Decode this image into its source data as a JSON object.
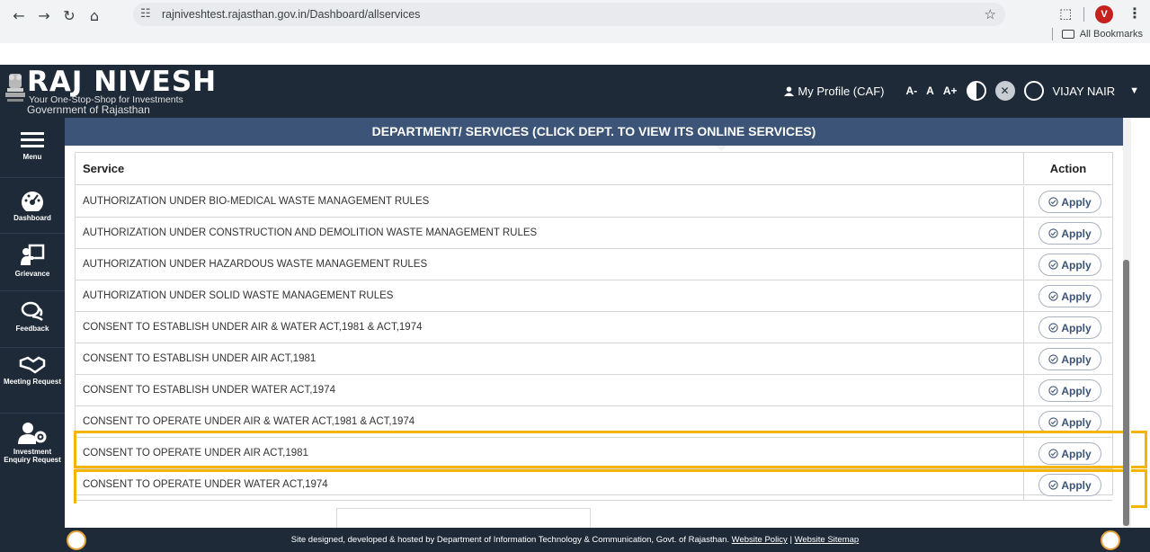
{
  "browser": {
    "url": "rajniveshtest.rajasthan.gov.in/Dashboard/allservices",
    "profile_initial": "V",
    "bookmarks_label": "All Bookmarks"
  },
  "header": {
    "brand": "RAJ NIVESH",
    "tagline": "Your One-Stop-Shop for Investments",
    "government": "Government of Rajasthan",
    "profile_link": "My Profile (CAF)",
    "font_small": "A-",
    "font_normal": "A",
    "font_large": "A+",
    "user_name": "VIJAY NAIR"
  },
  "sidebar": {
    "items": [
      {
        "label": "Menu",
        "icon": "hamburger-icon"
      },
      {
        "label": "Dashboard",
        "icon": "gauge-icon"
      },
      {
        "label": "Grievance",
        "icon": "presenter-icon"
      },
      {
        "label": "Feedback",
        "icon": "chat-icon"
      },
      {
        "label": "Meeting Request",
        "icon": "handshake-icon"
      },
      {
        "label": "Investment Enquiry Request",
        "icon": "user-gear-icon"
      }
    ]
  },
  "page": {
    "dept_heading": "DEPARTMENT/ SERVICES (CLICK DEPT. TO VIEW ITS ONLINE SERVICES)"
  },
  "table": {
    "col_service": "Service",
    "col_action": "Action",
    "apply_label": "Apply",
    "rows": [
      "AUTHORIZATION UNDER BIO-MEDICAL WASTE MANAGEMENT RULES",
      "AUTHORIZATION UNDER CONSTRUCTION AND DEMOLITION WASTE MANAGEMENT RULES",
      "AUTHORIZATION UNDER HAZARDOUS WASTE MANAGEMENT RULES",
      "AUTHORIZATION UNDER SOLID WASTE MANAGEMENT RULES",
      "CONSENT TO ESTABLISH UNDER AIR & WATER ACT,1981 & ACT,1974",
      "CONSENT TO ESTABLISH UNDER AIR ACT,1981",
      "CONSENT TO ESTABLISH UNDER WATER ACT,1974",
      "CONSENT TO OPERATE UNDER AIR & WATER ACT,1981 & ACT,1974",
      "CONSENT TO OPERATE UNDER AIR ACT,1981",
      "CONSENT TO OPERATE UNDER WATER ACT,1974"
    ]
  },
  "footer": {
    "text": "Site designed, developed & hosted by Department of Information Technology & Communication, Govt. of Rajasthan.",
    "policy_link": "Website Policy",
    "divider": "|",
    "sitemap_link": "Website Sitemap"
  },
  "colors": {
    "header_bg": "#1e2a38",
    "dept_bar": "#3b5477",
    "highlight": "#f4b400",
    "avatar": "#c5221f"
  }
}
